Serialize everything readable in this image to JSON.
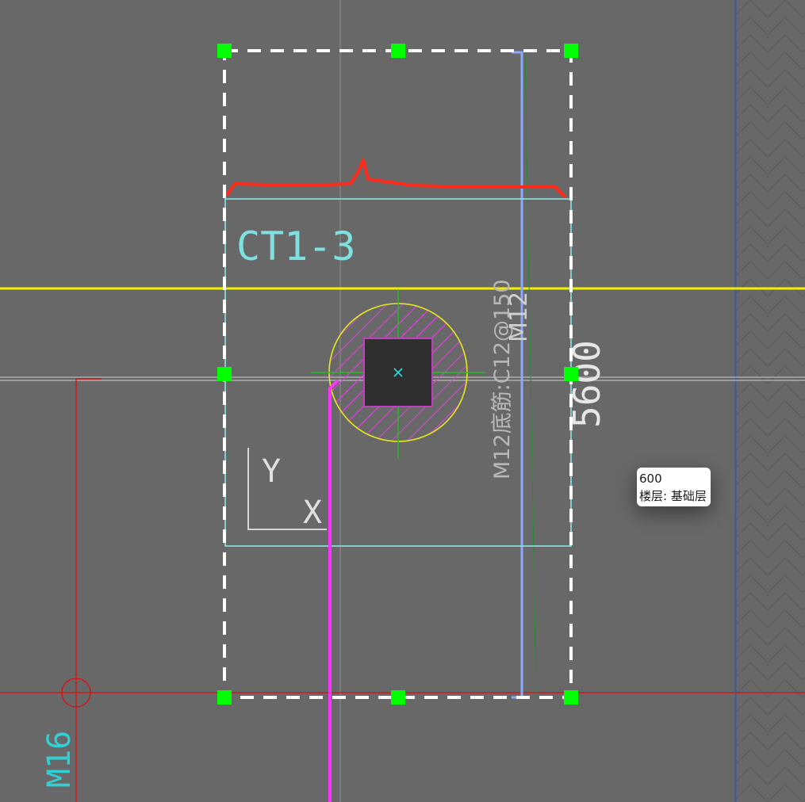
{
  "drawing": {
    "element_label": "CT1-3",
    "rebar_annotation": "M12底筋:C12@150",
    "dimension": "5600",
    "vertical_label": "M12",
    "axis_y": "Y",
    "axis_x": "X",
    "grid_label": "M16"
  },
  "tooltip": {
    "value": "600",
    "floor_text": "楼层: 基础层"
  },
  "colors": {
    "background": "#686868",
    "selection_box": "#ffffff",
    "grip": "#00ff00",
    "element_outline": "#8fe3e3",
    "annotation_red": "#ff2a1a",
    "axis_yellow": "#f2f200",
    "magenta": "#ff33ff",
    "blue_line": "#8aa8ff",
    "grid_red": "#d01818"
  }
}
